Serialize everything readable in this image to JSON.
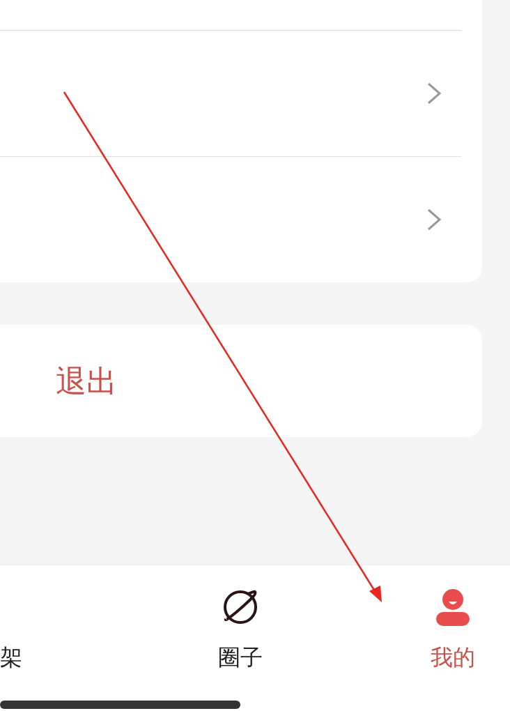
{
  "menu_rows": [
    {
      "kind": "chevron"
    },
    {
      "kind": "chevron"
    }
  ],
  "logout_button": {
    "label": "退出"
  },
  "tabs": [
    {
      "label": "架",
      "kind": "plain",
      "selected": false
    },
    {
      "label": "圈子",
      "kind": "planet",
      "selected": false
    },
    {
      "label": "我的",
      "kind": "person",
      "selected": true
    }
  ]
}
